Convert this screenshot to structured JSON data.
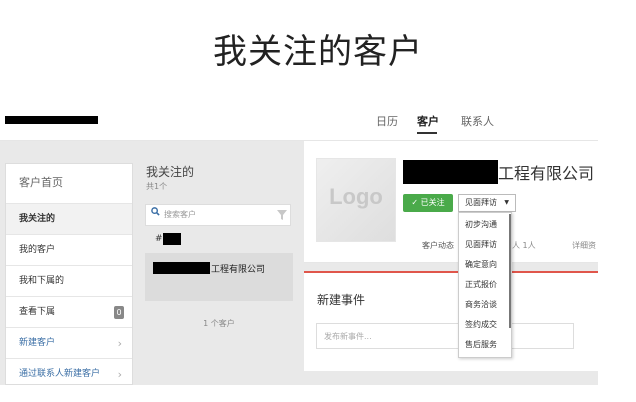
{
  "page": {
    "title": "我关注的客户"
  },
  "topnav": {
    "items": [
      {
        "label": "日历"
      },
      {
        "label": "客户"
      },
      {
        "label": "联系人"
      }
    ],
    "active_index": 1
  },
  "sidebar": {
    "home_label": "客户首页",
    "items": [
      {
        "label": "我关注的",
        "active": true
      },
      {
        "label": "我的客户"
      },
      {
        "label": "我和下属的"
      },
      {
        "label": "查看下属",
        "badge": "0"
      },
      {
        "label": "新建客户",
        "link": true
      },
      {
        "label": "通过联系人新建客户",
        "link": true
      }
    ]
  },
  "list": {
    "title": "我关注的",
    "subtitle": "共1个",
    "search_placeholder": "搜索客户",
    "alpha_group": "#",
    "rows": [
      {
        "name_suffix": "工程有限公司"
      }
    ],
    "count_text": "1 个客户"
  },
  "detail": {
    "logo_text": "Logo",
    "name_suffix": "工程有限公司",
    "follow_label": "✓ 已关注",
    "stage_value": "见面拜访",
    "tabs": [
      {
        "label": "客户动态"
      },
      {
        "label": "人 1人"
      },
      {
        "label": "详细资"
      }
    ],
    "event_title": "新建事件",
    "event_placeholder": "发布新事件..."
  },
  "stage_dropdown": {
    "options": [
      "初步沟通",
      "见面拜访",
      "确定意向",
      "正式报价",
      "商务洽谈",
      "签约成交",
      "售后服务"
    ],
    "selected_index": 1
  },
  "colors": {
    "accent_green": "#4aaa4a",
    "link_blue": "#3a6ea5",
    "event_accent": "#e0564b"
  }
}
